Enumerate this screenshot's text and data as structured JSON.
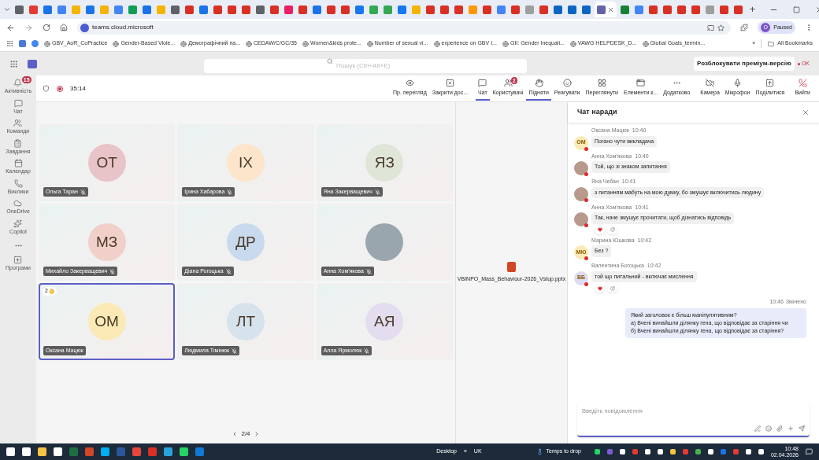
{
  "browser": {
    "tabs": [
      {
        "color": "#5f6368",
        "selected": false
      },
      {
        "color": "#e53935",
        "selected": false
      },
      {
        "color": "#1a73e8",
        "selected": false
      },
      {
        "color": "#4285f4",
        "selected": false
      },
      {
        "color": "#f4b400",
        "selected": false
      },
      {
        "color": "#1a73e8",
        "selected": false
      },
      {
        "color": "#f4b400",
        "selected": false
      },
      {
        "color": "#4285f4",
        "selected": false
      },
      {
        "color": "#0f9d58",
        "selected": false
      },
      {
        "color": "#1a73e8",
        "selected": false
      },
      {
        "color": "#f4b400",
        "selected": false
      },
      {
        "color": "#5f6368",
        "selected": false
      },
      {
        "color": "#d93025",
        "selected": false
      },
      {
        "color": "#1a73e8",
        "selected": false
      },
      {
        "color": "#d93025",
        "selected": false
      },
      {
        "color": "#d93025",
        "selected": false
      },
      {
        "color": "#d93025",
        "selected": false
      },
      {
        "color": "#5f6368",
        "selected": false
      },
      {
        "color": "#d93025",
        "selected": false
      },
      {
        "color": "#e91e63",
        "selected": false
      },
      {
        "color": "#d93025",
        "selected": false
      },
      {
        "color": "#1a73e8",
        "selected": false
      },
      {
        "color": "#d93025",
        "selected": false
      },
      {
        "color": "#d93025",
        "selected": false
      },
      {
        "color": "#1877f2",
        "selected": false
      },
      {
        "color": "#34a853",
        "selected": false
      },
      {
        "color": "#34a853",
        "selected": false
      },
      {
        "color": "#1877f2",
        "selected": false
      },
      {
        "color": "#f4b400",
        "selected": false
      },
      {
        "color": "#d93025",
        "selected": false
      },
      {
        "color": "#d93025",
        "selected": false
      },
      {
        "color": "#d93025",
        "selected": false
      },
      {
        "color": "#ff9800",
        "selected": false
      },
      {
        "color": "#d93025",
        "selected": false
      },
      {
        "color": "#4285f4",
        "selected": false
      },
      {
        "color": "#d93025",
        "selected": false
      },
      {
        "color": "#9e9e9e",
        "selected": false
      },
      {
        "color": "#d93025",
        "selected": false
      },
      {
        "color": "#0a66c2",
        "selected": false
      },
      {
        "color": "#0a66c2",
        "selected": false
      },
      {
        "color": "#0a66c2",
        "selected": false
      },
      {
        "color": "#6264a7",
        "selected": true
      },
      {
        "color": "#188038",
        "selected": false
      },
      {
        "color": "#4285f4",
        "selected": false
      },
      {
        "color": "#d93025",
        "selected": false
      },
      {
        "color": "#d93025",
        "selected": false
      },
      {
        "color": "#d93025",
        "selected": false
      },
      {
        "color": "#d93025",
        "selected": false
      },
      {
        "color": "#9e9e9e",
        "selected": false
      },
      {
        "color": "#d93025",
        "selected": false
      },
      {
        "color": "#d93025",
        "selected": false
      }
    ],
    "new_tab": "+",
    "url": "teams.cloud.microsoft",
    "profile": {
      "initial": "O",
      "label": "Paused"
    },
    "bookmarks": [
      "GBV_AoR_CoPractice",
      "Gender-Based Viole...",
      "Демографічний па...",
      "CEDAW/C/GC/35",
      "Women&kids prote...",
      "Number of sexual vi...",
      "experience on GBV I...",
      "GII: Gender Inequali...",
      "VAWG HELPDESK_D...",
      "Global Goals_termin..."
    ],
    "more": "»",
    "all_bookmarks": "All Bookmarks"
  },
  "teams_header": {
    "search": {
      "placeholder": "Пошук (Ctrl+Alt+E)"
    },
    "premium": "Розблокувати преміум-версію",
    "premium_badge": "OK"
  },
  "sidebar": {
    "items": [
      {
        "label": "Активність",
        "badge": "15"
      },
      {
        "label": "Чат"
      },
      {
        "label": "Команди"
      },
      {
        "label": "Завдання"
      },
      {
        "label": "Календар"
      },
      {
        "label": "Виклики"
      },
      {
        "label": "OneDrive"
      },
      {
        "label": "Copilot"
      },
      {
        "label": "Програми"
      }
    ]
  },
  "meeting": {
    "timer": "35:14",
    "toolbar": [
      {
        "label": "Пр. перегляд",
        "selected": false
      },
      {
        "label": "Закрити дос...",
        "selected": false
      },
      {
        "label": "Чат",
        "selected": true
      },
      {
        "label": "Користувачі",
        "selected": false,
        "badge": "2"
      },
      {
        "label": "Підняти",
        "selected": true
      },
      {
        "label": "Реагувати",
        "selected": false
      },
      {
        "label": "Переглянути",
        "selected": false
      },
      {
        "label": "Елементи к...",
        "selected": false
      },
      {
        "label": "Додатково",
        "selected": false
      },
      {
        "label": "Камера",
        "selected": false
      },
      {
        "label": "Мікрофон",
        "selected": false
      },
      {
        "label": "Поділитися",
        "selected": false
      },
      {
        "label": "Вийти",
        "selected": false
      }
    ],
    "participants": [
      {
        "kind": "initials",
        "initials": "ОТ",
        "name": "Ольга Таран",
        "color": "#e8c4c8",
        "muted": true,
        "selected": false
      },
      {
        "kind": "initials",
        "initials": "ІХ",
        "name": "Ірина Хабарова",
        "color": "#fde5cb",
        "muted": true,
        "selected": false
      },
      {
        "kind": "initials",
        "initials": "ЯЗ",
        "name": "Яна Закерващевич",
        "color": "#dfe6d8",
        "muted": true,
        "selected": false
      },
      {
        "kind": "initials",
        "initials": "МЗ",
        "name": "Михайло Закерващевич",
        "color": "#f1d0c9",
        "muted": true,
        "selected": false
      },
      {
        "kind": "initials",
        "initials": "ДР",
        "name": "Діана Рогоцька",
        "color": "#c9d9ee",
        "muted": true,
        "selected": false
      },
      {
        "kind": "photo",
        "name": "Анна Хом'якова",
        "muted": true,
        "selected": false
      },
      {
        "kind": "initials",
        "initials": "ОМ",
        "name": "Оксана Мацюк",
        "color": "#fbeab6",
        "muted": false,
        "selected": true,
        "hand": "2"
      },
      {
        "kind": "initials",
        "initials": "ЛТ",
        "name": "Людмила Тімінюк",
        "color": "#d7e3ec",
        "muted": true,
        "selected": false
      },
      {
        "kind": "initials",
        "initials": "АЯ",
        "name": "Алла Ярмолюк",
        "color": "#e3ddef",
        "muted": true,
        "selected": false
      }
    ],
    "page": "2/4",
    "shared_file": "VBINPO_Mass_Behaviour-2026_Vstup.pptx"
  },
  "chat": {
    "title": "Чат наради",
    "messages": [
      {
        "kind": "incoming",
        "author": "Оксана Мацюк",
        "time": "10:40",
        "initials": "ОМ",
        "color": "#fbeab6",
        "text": "Погано чути викладача",
        "reactions": false
      },
      {
        "kind": "incoming",
        "author": "Анна Хом'якова",
        "time": "10:40",
        "text": "Той, що зі знаком запитання",
        "reactions": false
      },
      {
        "kind": "incoming",
        "author": "Яна Чебан",
        "time": "10:41",
        "text": "з питанням мабуть  на мою думку, бо змушує включитись людину",
        "reactions": false
      },
      {
        "kind": "incoming",
        "author": "Анна Хом'якова",
        "time": "10:41",
        "text": "Так, наче змушує прочитати, щоб дізнатись відповідь",
        "reactions": true
      },
      {
        "kind": "incoming",
        "author": "Марина Юшкова",
        "time": "10:42",
        "initials": "МЮ",
        "color": "#fbeab6",
        "text": "Без ?",
        "reactions": false
      },
      {
        "kind": "incoming",
        "author": "Валентина Богоцька",
        "time": "10:42",
        "initials": "ВБ",
        "color": "#dcdcf2",
        "text": "той що питальний - включає мислення",
        "reactions": true
      },
      {
        "kind": "outgoing",
        "time": "10:46",
        "edited": "Змінено",
        "lines": [
          "Який заголовок є більш маніпулятивним?",
          "а) Вчені винайшли ділянку гена, що відповідає за старіння чи",
          "б) Вчені винайшли ділянку гена, що відповідає за старіння?"
        ]
      }
    ],
    "compose": {
      "placeholder": "Введіть повідомлення"
    }
  },
  "taskbar": {
    "desktop": "Desktop",
    "more": "»",
    "lang": "UK",
    "weather": "Temps to drop",
    "time": "10:48",
    "date": "02.04.2026"
  }
}
